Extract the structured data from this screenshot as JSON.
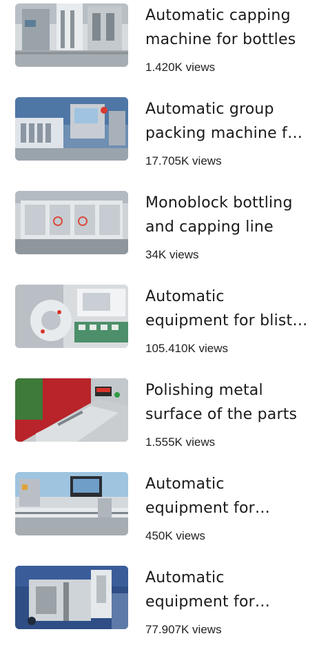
{
  "videos": [
    {
      "title": "Automatic capping machine for bottles",
      "views": "1.420K views",
      "thumb": "capping-machine-thumbnail"
    },
    {
      "title": "Automatic group packing machine for blisters",
      "views": "17.705K views",
      "thumb": "group-packing-machine-thumbnail"
    },
    {
      "title": "Monoblock bottling and capping line",
      "views": "34K views",
      "thumb": "monoblock-bottling-thumbnail"
    },
    {
      "title": "Automatic equipment for blister packing",
      "views": "105.410K views",
      "thumb": "blister-equipment-thumbnail"
    },
    {
      "title": "Polishing metal surface of the parts",
      "views": "1.555K views",
      "thumb": "polishing-metal-thumbnail"
    },
    {
      "title": "Automatic equipment for labeling",
      "views": "450K views",
      "thumb": "labeling-equipment-thumbnail"
    },
    {
      "title": "Automatic equipment for assembly",
      "views": "77.907K views",
      "thumb": "assembly-equipment-thumbnail"
    }
  ]
}
